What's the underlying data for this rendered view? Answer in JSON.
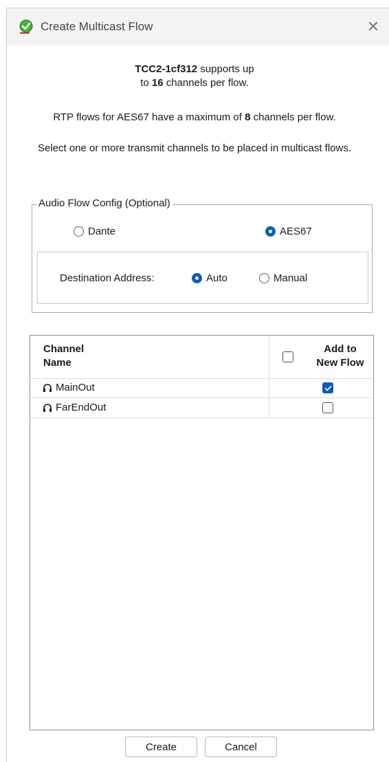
{
  "window": {
    "title": "Create Multicast Flow",
    "close_glyph": "✕"
  },
  "info": {
    "device_name": "TCC2-1cf312",
    "supports_text": " supports up",
    "line2_prefix": "to ",
    "max_channels": "16",
    "line2_suffix": " channels per flow.",
    "aes67_prefix": "RTP flows for AES67 have a maximum of ",
    "aes67_max": "8",
    "aes67_suffix": " channels per flow.",
    "instruction": "Select one or more transmit channels to be placed in multicast flows."
  },
  "audio_flow_config": {
    "legend": "Audio Flow Config (Optional)",
    "protocol_options": [
      {
        "label": "Dante",
        "selected": false
      },
      {
        "label": "AES67",
        "selected": true
      }
    ],
    "destination_label": "Destination Address:",
    "destination_options": [
      {
        "label": "Auto",
        "selected": true
      },
      {
        "label": "Manual",
        "selected": false
      }
    ]
  },
  "channel_table": {
    "col_name_line1": "Channel",
    "col_name_line2": "Name",
    "col_add_line1": "Add to",
    "col_add_line2": "New Flow",
    "select_all_checked": false,
    "rows": [
      {
        "name": "MainOut",
        "add": true
      },
      {
        "name": "FarEndOut",
        "add": false
      }
    ]
  },
  "buttons": {
    "create": "Create",
    "cancel": "Cancel"
  },
  "colors": {
    "accent": "#0a5bc4",
    "app_icon": "#4caf3a"
  }
}
